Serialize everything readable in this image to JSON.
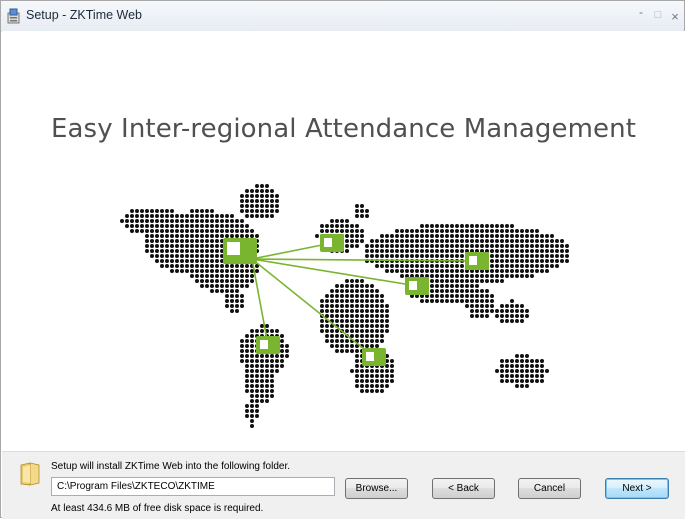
{
  "window": {
    "title": "Setup - ZKTime Web",
    "controls": {
      "minimize": "-",
      "maximize": "□",
      "close": "×"
    }
  },
  "banner": {
    "title": "Easy Inter-regional Attendance Management",
    "map_icon": "world-dot-map",
    "hub_icon": "attendance-device-icon",
    "accent_color": "#7ab52f"
  },
  "install": {
    "message": "Setup will install ZKTime Web into the following folder.",
    "path": "C:\\Program Files\\ZKTECO\\ZKTIME",
    "disk_space": "At least 434.6 MB of free disk space is required."
  },
  "buttons": {
    "browse": "Browse...",
    "back": "< Back",
    "cancel": "Cancel",
    "next": "Next >"
  }
}
